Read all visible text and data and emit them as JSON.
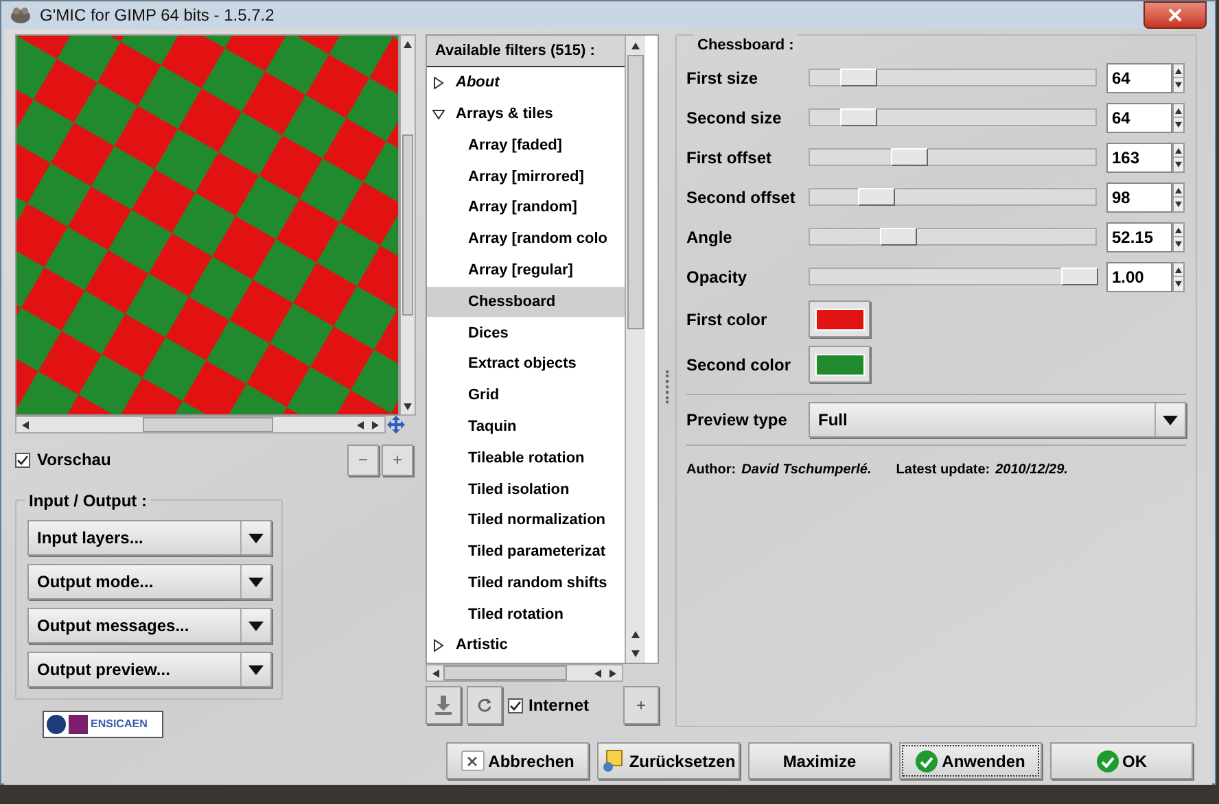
{
  "window": {
    "title": "G'MIC for GIMP 64 bits - 1.5.7.2"
  },
  "preview": {
    "checkbox": {
      "label": "Vorschau",
      "checked": true
    },
    "zoom_buttons": [
      "−",
      "+"
    ]
  },
  "input_output": {
    "title": "Input / Output :",
    "dropdowns": [
      "Input layers...",
      "Output mode...",
      "Output messages...",
      "Output preview..."
    ]
  },
  "logo": {
    "text": "ENSICAEN"
  },
  "filters": {
    "header": "Available filters (515) :",
    "tree": [
      {
        "label": "About",
        "expanded": false,
        "selected": false
      },
      {
        "label": "Arrays & tiles",
        "expanded": true,
        "selected": false,
        "children": [
          {
            "label": "Array [faded]",
            "selected": false
          },
          {
            "label": "Array [mirrored]",
            "selected": false
          },
          {
            "label": "Array [random]",
            "selected": false
          },
          {
            "label": "Array [random colo",
            "selected": false
          },
          {
            "label": "Array [regular]",
            "selected": false
          },
          {
            "label": "Chessboard",
            "selected": true
          },
          {
            "label": "Dices",
            "selected": false
          },
          {
            "label": "Extract objects",
            "selected": false
          },
          {
            "label": "Grid",
            "selected": false
          },
          {
            "label": "Taquin",
            "selected": false
          },
          {
            "label": "Tileable rotation",
            "selected": false
          },
          {
            "label": "Tiled isolation",
            "selected": false
          },
          {
            "label": "Tiled normalization",
            "selected": false
          },
          {
            "label": "Tiled parameterizat",
            "selected": false
          },
          {
            "label": "Tiled random shifts",
            "selected": false
          },
          {
            "label": "Tiled rotation",
            "selected": false
          }
        ]
      },
      {
        "label": "Artistic",
        "expanded": false,
        "selected": false
      }
    ],
    "internet": {
      "label": "Internet",
      "checked": true
    },
    "add_button": "+"
  },
  "settings": {
    "title": "Chessboard :",
    "params": [
      {
        "kind": "slider",
        "label": "First size",
        "level": 0.12,
        "value": "64"
      },
      {
        "kind": "slider",
        "label": "Second size",
        "level": 0.12,
        "value": "64"
      },
      {
        "kind": "slider",
        "label": "First offset",
        "level": 0.32,
        "value": "163"
      },
      {
        "kind": "slider",
        "label": "Second offset",
        "level": 0.19,
        "value": "98"
      },
      {
        "kind": "slider",
        "label": "Angle",
        "level": 0.28,
        "value": "52.15"
      },
      {
        "kind": "slider",
        "label": "Opacity",
        "level": 1.0,
        "value": "1.00"
      },
      {
        "kind": "color",
        "label": "First color",
        "color": "#e21212"
      },
      {
        "kind": "color",
        "label": "Second color",
        "color": "#218a2f"
      }
    ],
    "preview_type": {
      "label": "Preview type",
      "value": "Full"
    },
    "author_label": "Author:",
    "author": "David Tschumperlé.",
    "update_label": "Latest update:",
    "update": "2010/12/29."
  },
  "buttons": [
    {
      "kind": "cancel",
      "label": "Abbrechen"
    },
    {
      "kind": "reset",
      "label": "Zurücksetzen"
    },
    {
      "kind": "plain",
      "label": "Maximize"
    },
    {
      "kind": "apply",
      "label": "Anwenden"
    },
    {
      "kind": "ok",
      "label": "OK"
    }
  ]
}
